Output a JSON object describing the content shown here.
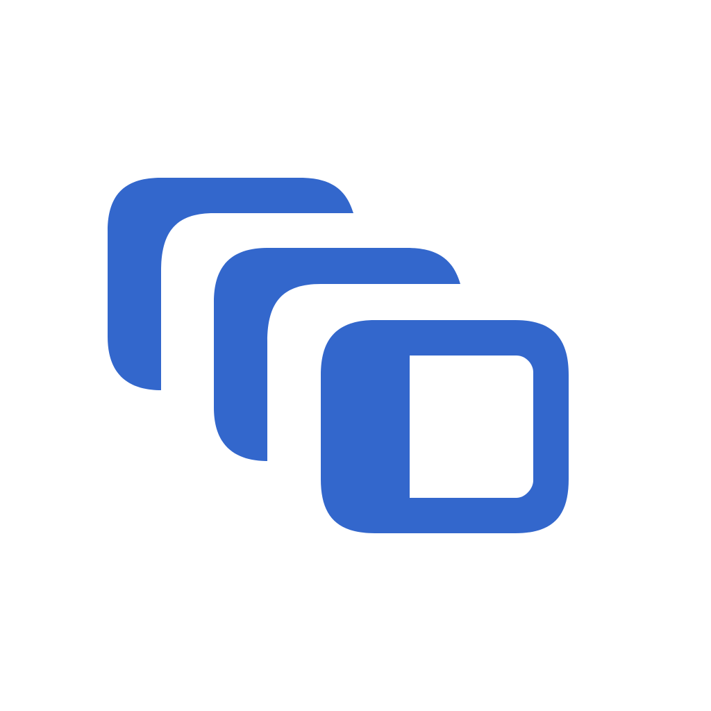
{
  "icon": {
    "name": "stacked-windows-icon",
    "colors": {
      "primary": "#3367CC",
      "background": "#FFFFFF"
    }
  }
}
